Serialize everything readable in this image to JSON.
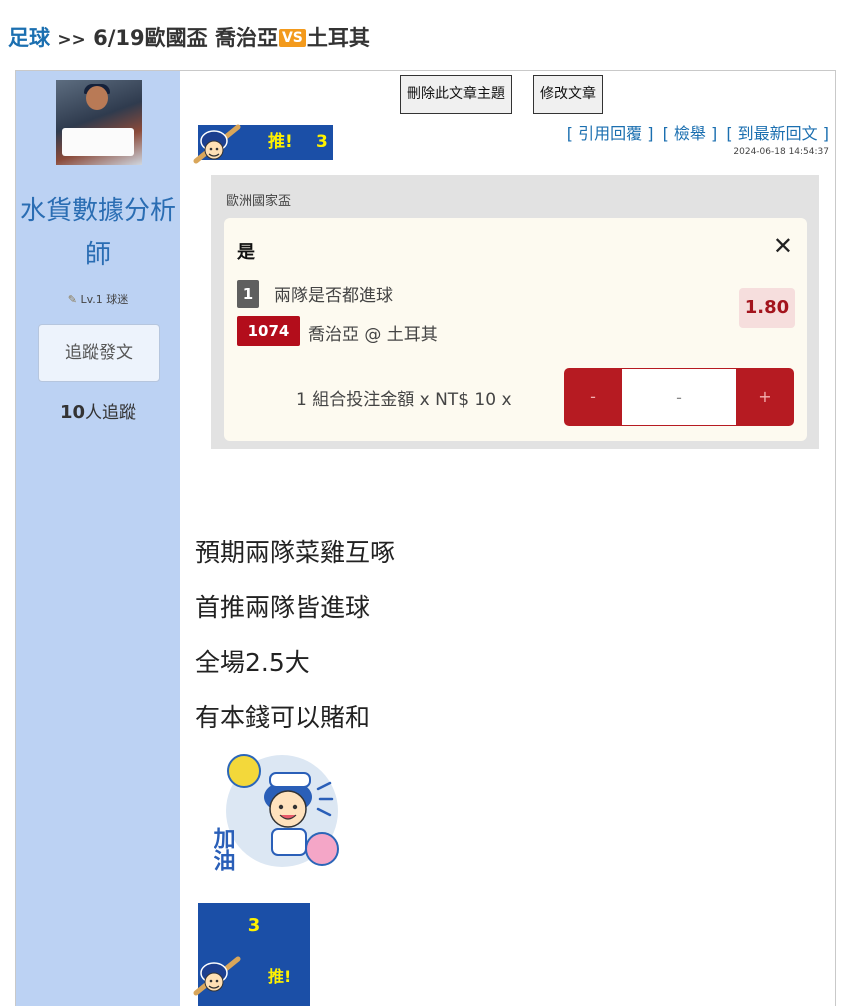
{
  "breadcrumb": {
    "category": "足球",
    "separator": ">>",
    "title_prefix": "6/19歐國盃 喬治亞",
    "vs_badge": "VS",
    "title_suffix": "土耳其"
  },
  "author": {
    "name": "水貨數據分析師",
    "level": "Lv.1 球迷",
    "follow_button": "追蹤發文",
    "follower_count": "10",
    "follower_suffix": "人追蹤"
  },
  "toolbar": {
    "delete_topic": "刪除此文章主題",
    "edit_post": "修改文章"
  },
  "push": {
    "label": "推!",
    "count": "3"
  },
  "post_links": {
    "quote_reply": "[ 引用回覆 ]",
    "report": "[ 檢舉 ]",
    "latest_reply": "[ 到最新回文 ]"
  },
  "post_date": "2024-06-18 14:54:37",
  "bet": {
    "league": "歐洲國家盃",
    "pick": "是",
    "market_tag": "1",
    "market": "兩隊是否都進球",
    "match_tag": "1074",
    "match": "喬治亞 @ 土耳其",
    "odds": "1.80",
    "stake_label": "1 組合投注金額 x NT$ 10 x",
    "stepper_minus": "-",
    "stepper_value": "-",
    "stepper_plus": "+"
  },
  "post_lines": [
    "預期兩隊菜雞互啄",
    "首推兩隊皆進球",
    "全場2.5大",
    "有本錢可以賭和"
  ],
  "sticker_text": "加油",
  "push_bottom": {
    "count": "3",
    "label": "推!"
  },
  "colors": {
    "sidebar": "#bcd2f3",
    "link": "#1b6fb0",
    "accent_red": "#b30d1b",
    "push_badge": "#1b4fa7"
  }
}
